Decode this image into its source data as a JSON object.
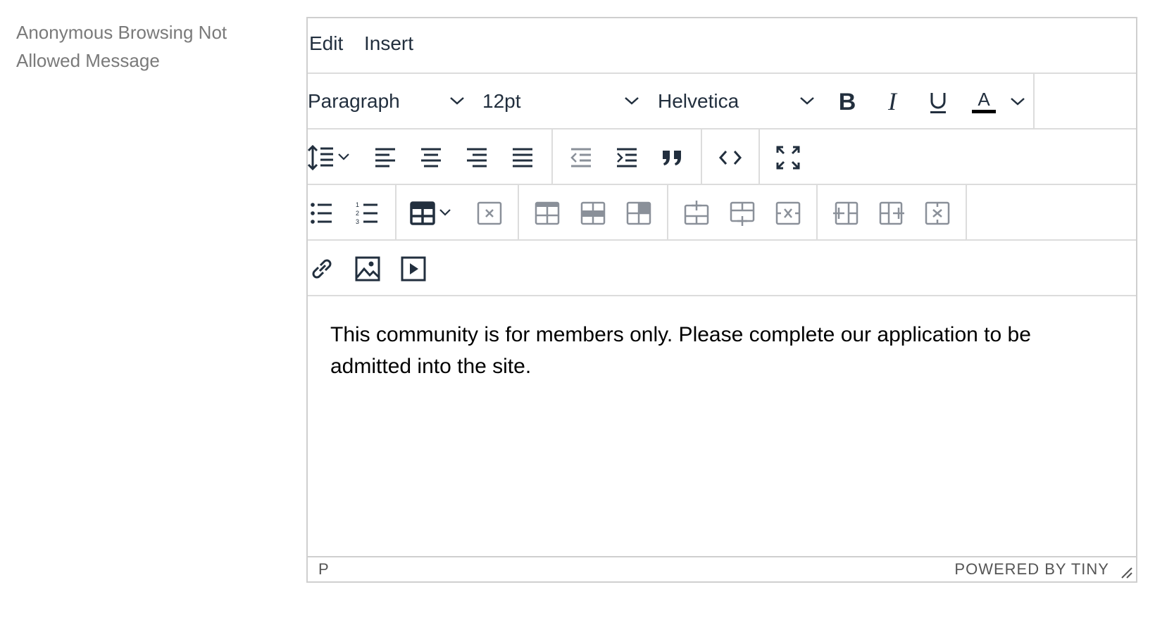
{
  "field": {
    "label": "Anonymous Browsing Not Allowed Message"
  },
  "menubar": {
    "items": [
      "Edit",
      "Insert"
    ]
  },
  "toolbar": {
    "block_format": "Paragraph",
    "font_size": "12pt",
    "font_family": "Helvetica",
    "text_color": "#000000"
  },
  "icons": {
    "row1": [
      "bold-icon",
      "italic-icon",
      "underline-icon",
      "text-color-icon",
      "chevron-down-icon"
    ],
    "row2": [
      "line-height-icon",
      "align-left-icon",
      "align-center-icon",
      "align-right-icon",
      "align-justify-icon",
      "outdent-icon",
      "indent-icon",
      "blockquote-icon",
      "code-icon",
      "fullscreen-icon"
    ],
    "row3": [
      "bullet-list-icon",
      "numbered-list-icon",
      "table-icon",
      "table-delete-icon",
      "table-cell-props-icon",
      "table-row-props-icon",
      "table-merge-cells-icon",
      "table-insert-row-before-icon",
      "table-insert-row-after-icon",
      "table-delete-row-icon",
      "table-insert-col-before-icon",
      "table-insert-col-after-icon",
      "table-delete-col-icon"
    ],
    "row4": [
      "link-icon",
      "image-icon",
      "media-icon"
    ]
  },
  "content": {
    "text": "This community is for members only. Please complete our application to be admitted into the site."
  },
  "statusbar": {
    "path": "P",
    "branding": "POWERED BY TINY"
  }
}
